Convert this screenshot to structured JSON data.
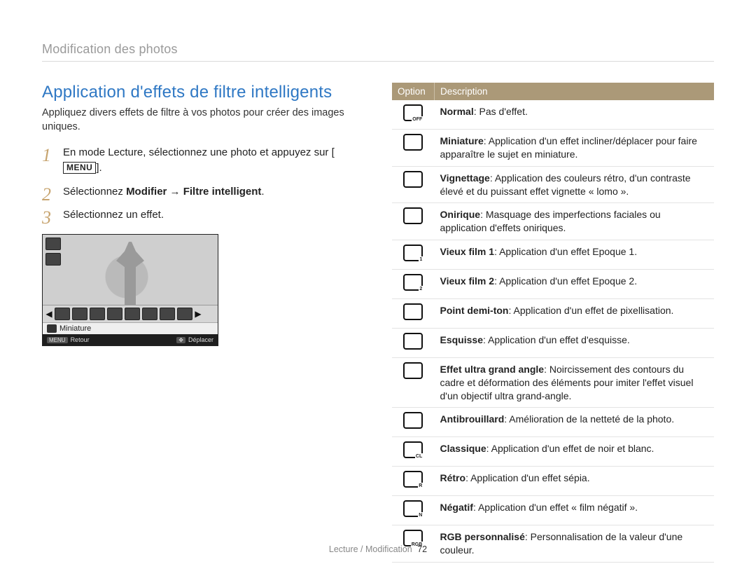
{
  "running_head": "Modification des photos",
  "section_title": "Application d'effets de filtre intelligents",
  "lead": "Appliquez divers effets de filtre à vos photos pour créer des images uniques.",
  "steps": {
    "s1_a": "En mode Lecture, sélectionnez une photo et appuyez sur ",
    "s1_menu": "MENU",
    "s1_b": ".",
    "s2_a": "Sélectionnez ",
    "s2_bold": "Modifier → Filtre intelligent",
    "s2_b": ".",
    "s3": "Sélectionnez un effet."
  },
  "lcd": {
    "selected_label": "Miniature",
    "foot_left_key": "MENU",
    "foot_left": "Retour",
    "foot_right_key": "✥",
    "foot_right": "Déplacer"
  },
  "table": {
    "h1": "Option",
    "h2": "Description",
    "rows": [
      {
        "sub": "OFF",
        "bold": "Normal",
        "rest": ": Pas d'effet."
      },
      {
        "sub": "",
        "bold": "Miniature",
        "rest": ": Application d'un effet incliner/déplacer pour faire apparaître le sujet en miniature."
      },
      {
        "sub": "",
        "bold": "Vignettage",
        "rest": ": Application des couleurs rétro, d'un contraste élevé et du puissant effet vignette « lomo »."
      },
      {
        "sub": "",
        "bold": "Onirique",
        "rest": ": Masquage des imperfections faciales ou application d'effets oniriques."
      },
      {
        "sub": "1",
        "bold": "Vieux film 1",
        "rest": ": Application d'un effet Epoque 1."
      },
      {
        "sub": "2",
        "bold": "Vieux film 2",
        "rest": ": Application d'un effet Epoque 2."
      },
      {
        "sub": "",
        "bold": "Point demi-ton",
        "rest": ": Application d'un effet de pixellisation."
      },
      {
        "sub": "",
        "bold": "Esquisse",
        "rest": ": Application d'un effet d'esquisse."
      },
      {
        "sub": "",
        "bold": "Effet ultra grand angle",
        "rest": ": Noircissement des contours du cadre et déformation des éléments pour imiter l'effet visuel d'un objectif ultra grand-angle."
      },
      {
        "sub": "",
        "bold": "Antibrouillard",
        "rest": ": Amélioration de la netteté de la photo."
      },
      {
        "sub": "CL",
        "bold": "Classique",
        "rest": ": Application d'un effet de noir et blanc."
      },
      {
        "sub": "R",
        "bold": "Rétro",
        "rest": ": Application d'un effet sépia."
      },
      {
        "sub": "N",
        "bold": "Négatif",
        "rest": ": Application d'un effet « film négatif »."
      },
      {
        "sub": "RGB",
        "bold": "RGB personnalisé",
        "rest": ": Personnalisation de la valeur d'une couleur."
      }
    ]
  },
  "footer": {
    "section": "Lecture / Modification",
    "page": "72"
  }
}
